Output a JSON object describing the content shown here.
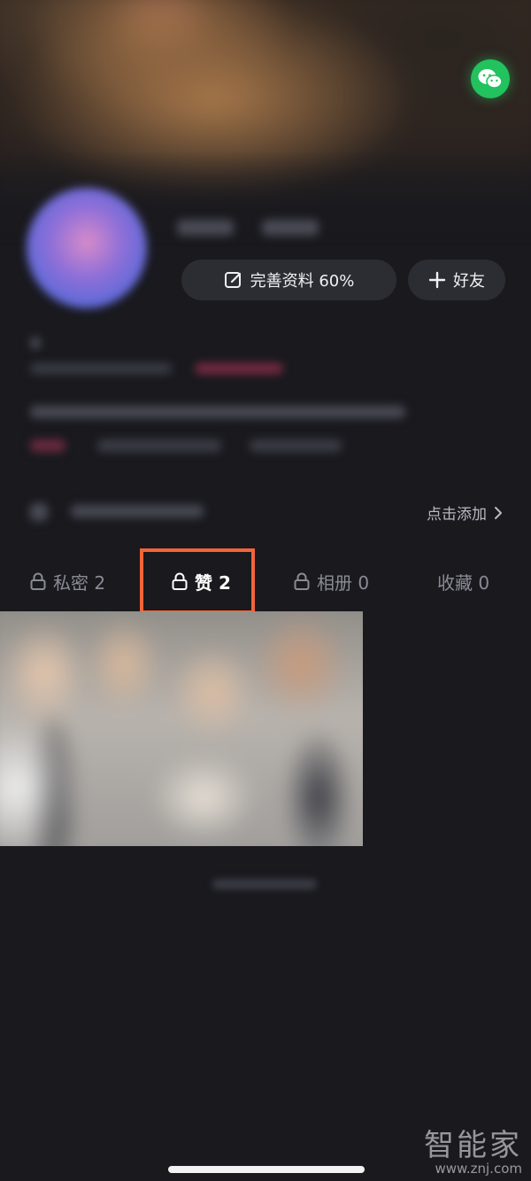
{
  "header": {
    "wechat_icon": "wechat-icon",
    "wechat_color": "#22c25f"
  },
  "profile": {
    "edit_button_label": "完善资料 60%",
    "add_friend_label": "好友",
    "edit_icon": "edit-icon",
    "plus_icon": "plus-icon"
  },
  "add_row": {
    "add_label": "点击添加",
    "chevron_icon": "chevron-right-icon"
  },
  "tabs": [
    {
      "label": "私密 2",
      "locked": true,
      "active": false
    },
    {
      "label": "赞 2",
      "locked": true,
      "active": true
    },
    {
      "label": "相册 0",
      "locked": true,
      "active": false
    },
    {
      "label": "收藏 0",
      "locked": false,
      "active": false
    }
  ],
  "highlight_color": "#f2643a",
  "watermark": {
    "brand": "智能家",
    "url": "www.znj.com"
  }
}
